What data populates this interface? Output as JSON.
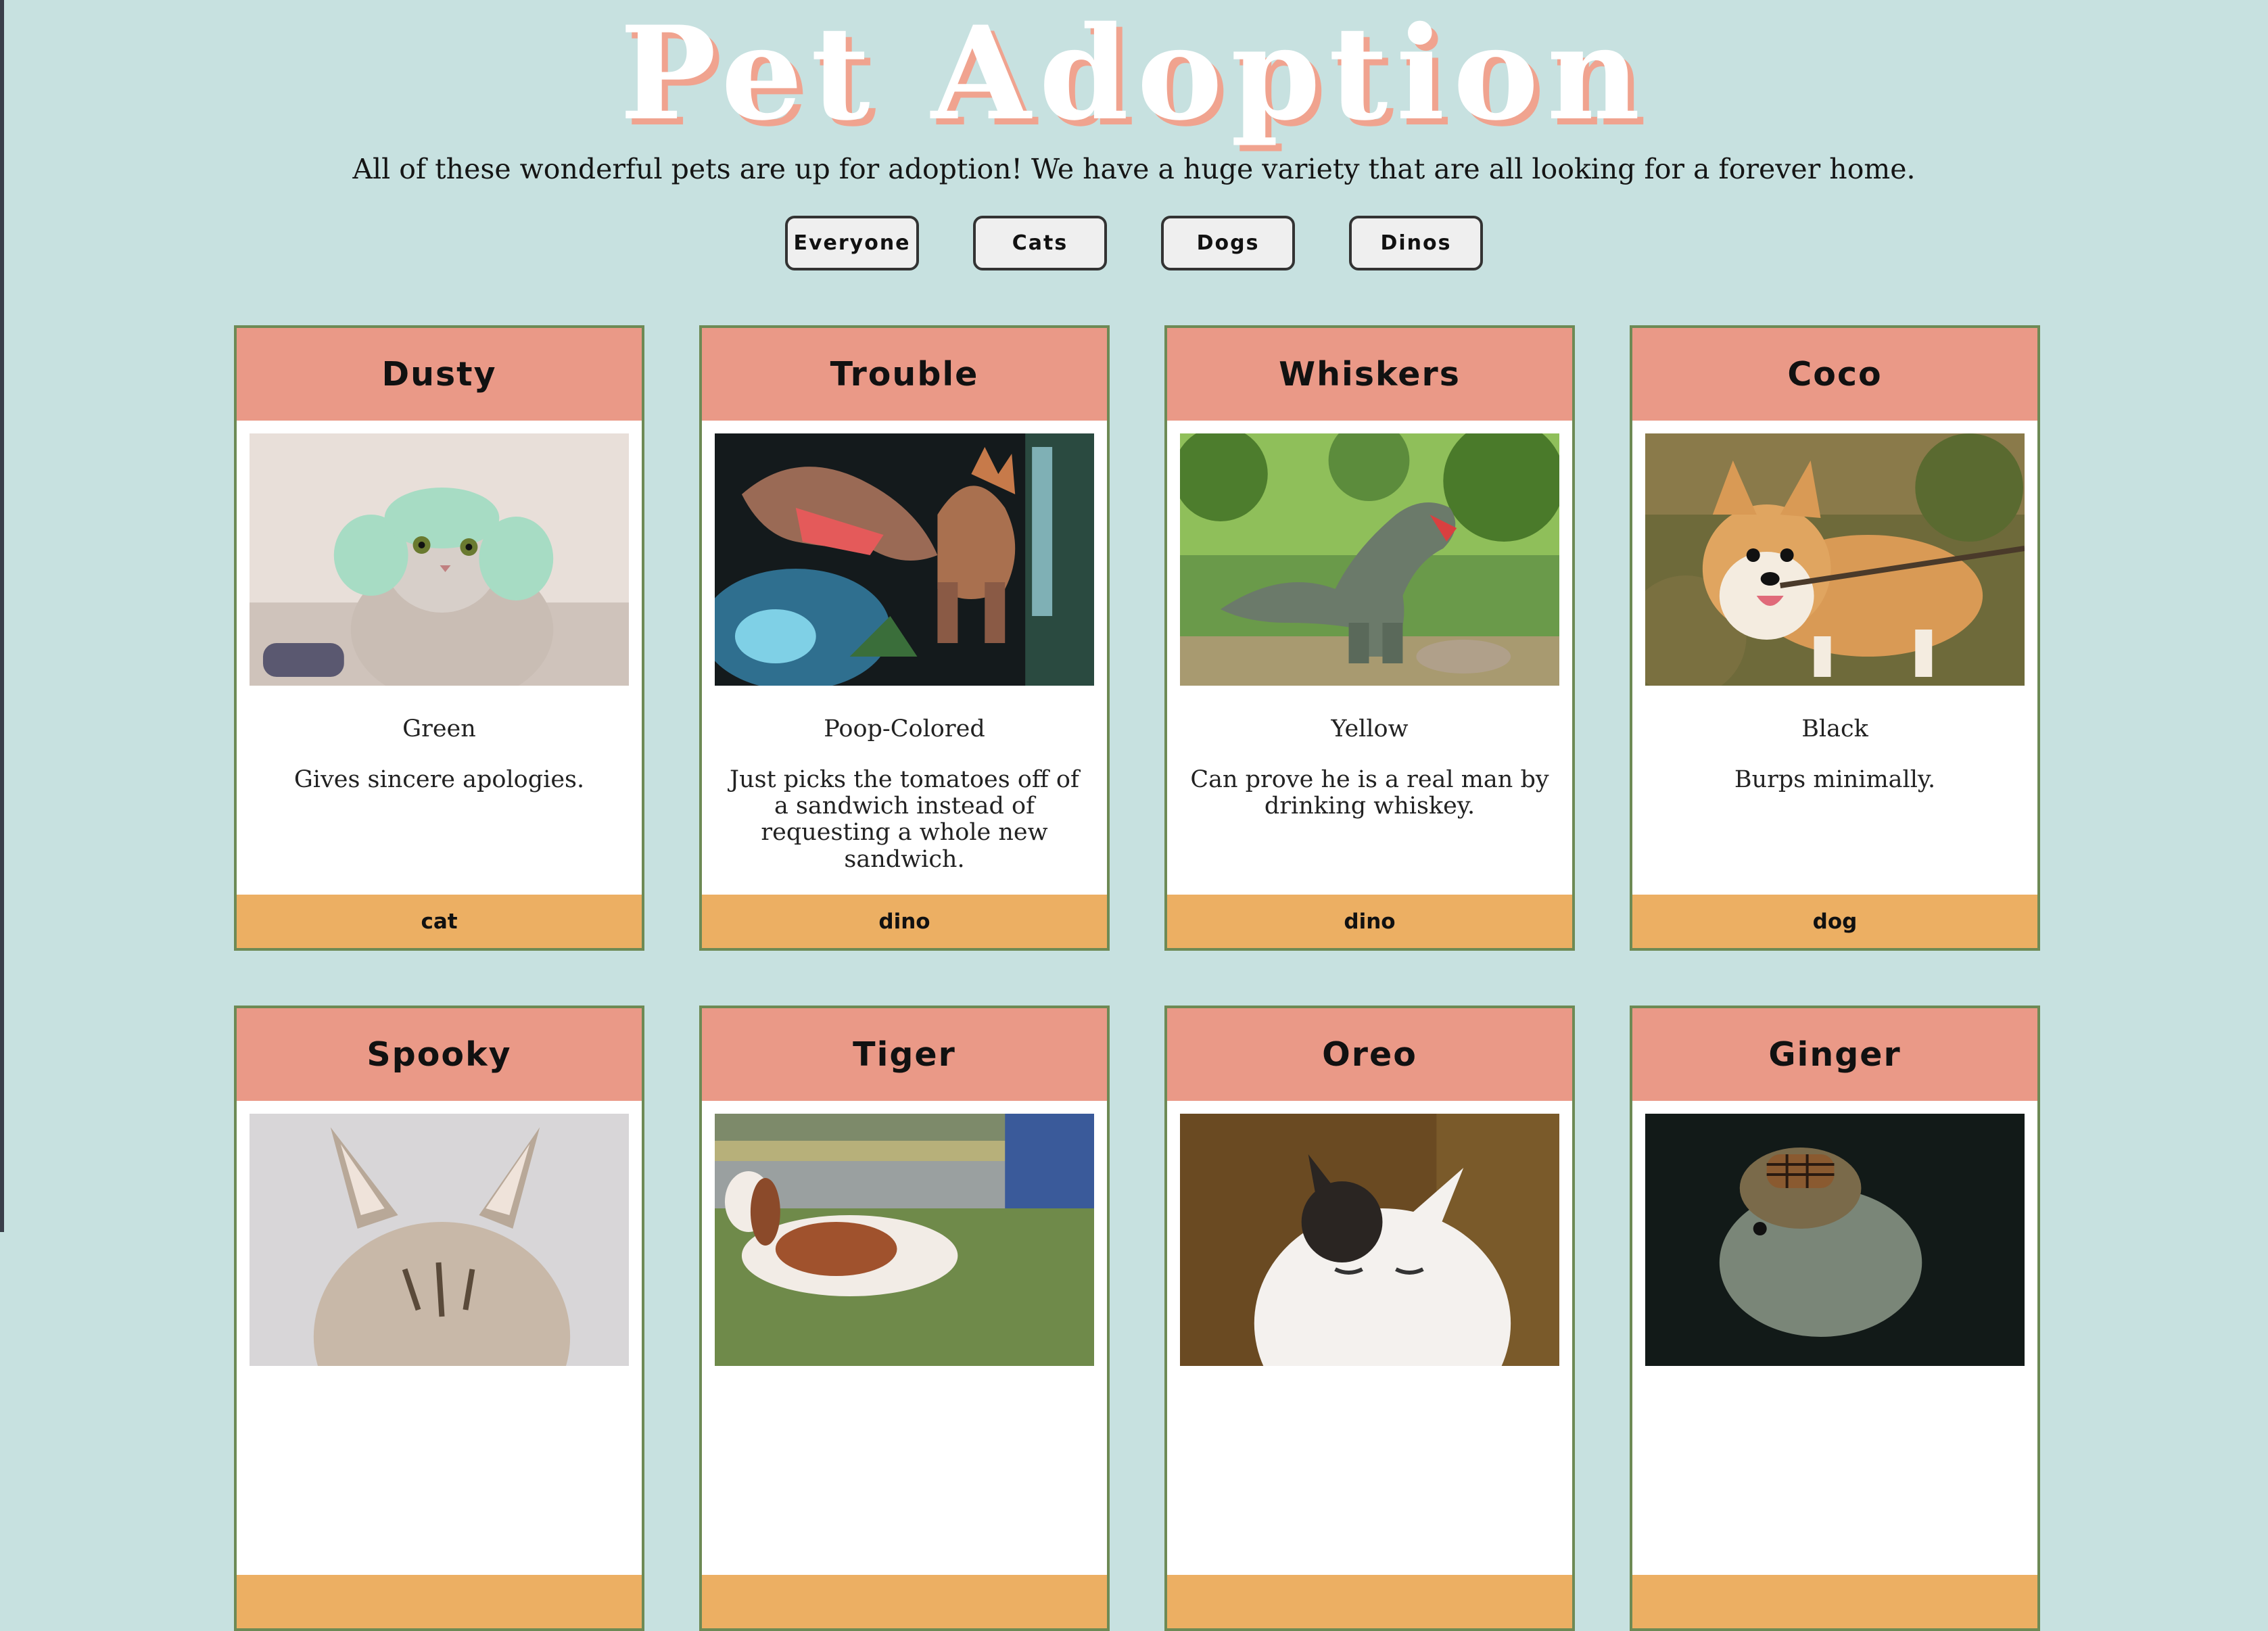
{
  "header": {
    "title": "Pet Adoption",
    "intro": "All of these wonderful pets are up for adoption! We have a huge variety that are all looking for a forever home."
  },
  "filters": [
    {
      "label": "Everyone"
    },
    {
      "label": "Cats"
    },
    {
      "label": "Dogs"
    },
    {
      "label": "Dinos"
    }
  ],
  "pets": [
    {
      "name": "Dusty",
      "color": "Green",
      "skill": "Gives sincere apologies.",
      "type": "cat",
      "photo": "cat-photo"
    },
    {
      "name": "Trouble",
      "color": "Poop-Colored",
      "skill": "Just picks the tomatoes off of a sandwich instead of requesting a whole new sandwich.",
      "type": "dino",
      "photo": "dino-photo"
    },
    {
      "name": "Whiskers",
      "color": "Yellow",
      "skill": "Can prove he is a real man by drinking whiskey.",
      "type": "dino",
      "photo": "dino-photo"
    },
    {
      "name": "Coco",
      "color": "Black",
      "skill": "Burps minimally.",
      "type": "dog",
      "photo": "dog-photo"
    },
    {
      "name": "Spooky",
      "color": "",
      "skill": "",
      "type": "",
      "photo": "cat-photo"
    },
    {
      "name": "Tiger",
      "color": "",
      "skill": "",
      "type": "",
      "photo": "dog-photo"
    },
    {
      "name": "Oreo",
      "color": "",
      "skill": "",
      "type": "",
      "photo": "cat-photo"
    },
    {
      "name": "Ginger",
      "color": "",
      "skill": "",
      "type": "",
      "photo": "dino-photo"
    }
  ],
  "colors": {
    "page_background": "#c7e1e0",
    "card_header": "#ea9987",
    "card_footer": "#ecaf63",
    "card_border": "#6d8a55",
    "title_shadow": "#f0a38f"
  }
}
